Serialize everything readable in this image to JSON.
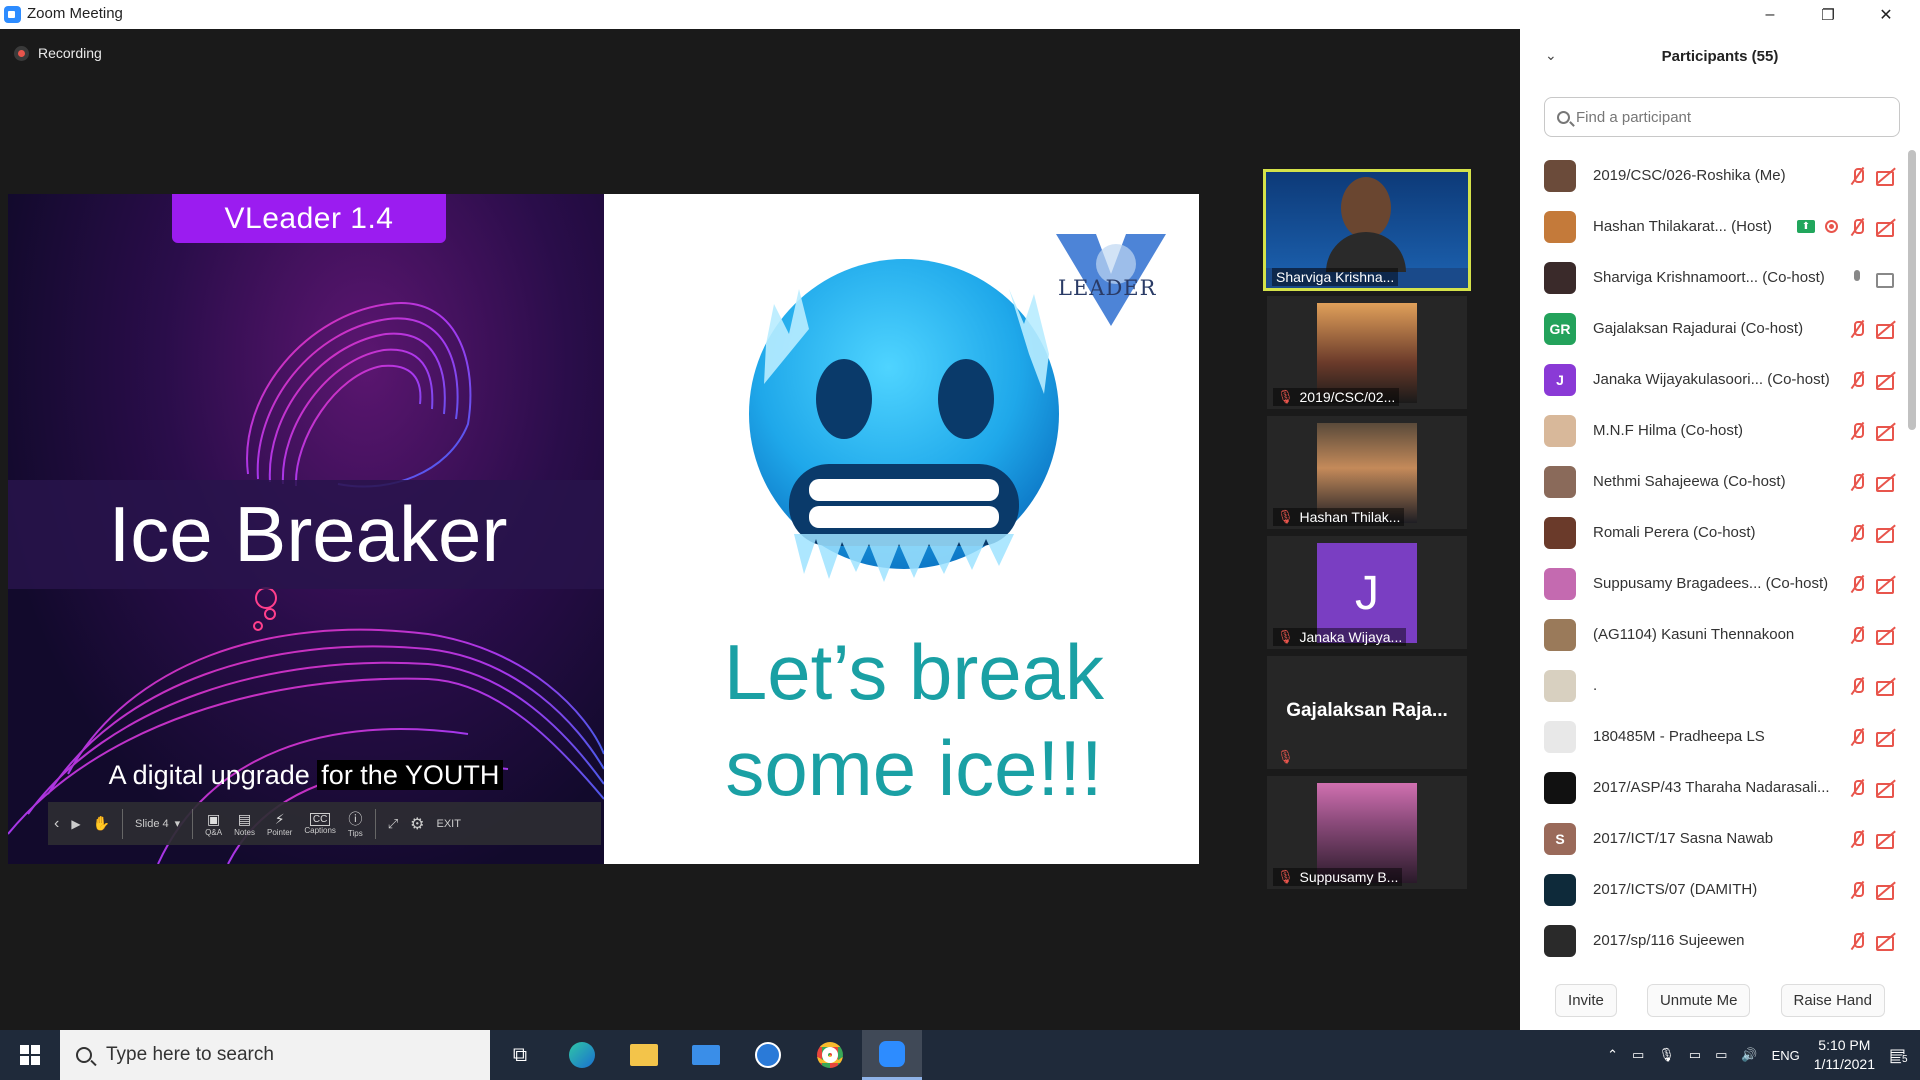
{
  "window": {
    "title": "Zoom Meeting",
    "minimize": "–",
    "restore": "❐",
    "close": "✕"
  },
  "meeting": {
    "recording_label": "Recording",
    "slide": {
      "badge": "VLeader 1.4",
      "headline": "Ice Breaker",
      "tagline_a": "A digital upgrade",
      "tagline_b": "for the YOUTH",
      "right_text_line1": "Let’s break",
      "right_text_line2": "some ice!!!",
      "logo_text": "LEADER",
      "toolbar": {
        "prev": "‹",
        "play": "▶",
        "slide_label": "Slide 4",
        "items": [
          {
            "icon": "▣",
            "label": "Q&A"
          },
          {
            "icon": "▤",
            "label": "Notes"
          },
          {
            "icon": "⚡",
            "label": "Pointer"
          },
          {
            "icon": "CC",
            "label": "Captions"
          },
          {
            "icon": "ⓘ",
            "label": "Tips"
          }
        ],
        "exit": "EXIT"
      }
    },
    "tiles": [
      {
        "name": "Sharviga Krishna..."
      },
      {
        "name": "2019/CSC/02..."
      },
      {
        "name": "Hashan Thilak..."
      },
      {
        "name": "Janaka Wijaya...",
        "initial": "J"
      },
      {
        "name": "Gajalaksan  Raja..."
      },
      {
        "name": "Suppusamy B..."
      }
    ]
  },
  "participants": {
    "title": "Participants (55)",
    "search_placeholder": "Find a participant",
    "list": [
      {
        "name": "2019/CSC/026-Roshika (Me)",
        "avatar": "",
        "color": "#6b4b3a"
      },
      {
        "name": "Hashan Thilakarat...  (Host)",
        "avatar": "",
        "color": "#c47a3a"
      },
      {
        "name": "Sharviga Krishnamoort...  (Co-host)",
        "avatar": "",
        "color": "#3a2a2a"
      },
      {
        "name": "Gajalaksan Rajadurai (Co-host)",
        "avatar": "GR",
        "color": "#23a25b"
      },
      {
        "name": "Janaka Wijayakulasoori...  (Co-host)",
        "avatar": "J",
        "color": "#8a3ad6"
      },
      {
        "name": "M.N.F Hilma (Co-host)",
        "avatar": "",
        "color": "#d8b89a"
      },
      {
        "name": "Nethmi Sahajeewa (Co-host)",
        "avatar": "",
        "color": "#8a6a5a"
      },
      {
        "name": "Romali Perera (Co-host)",
        "avatar": "",
        "color": "#6a3a2a"
      },
      {
        "name": "Suppusamy Bragadees...  (Co-host)",
        "avatar": "",
        "color": "#c46ab0"
      },
      {
        "name": "(AG1104) Kasuni Thennakoon",
        "avatar": "",
        "color": "#9a7a5a"
      },
      {
        "name": ".",
        "avatar": "",
        "color": "#d8d0c0"
      },
      {
        "name": "180485M - Pradheepa LS",
        "avatar": "",
        "color": "#e8e8e8"
      },
      {
        "name": "2017/ASP/43 Tharaha Nadarasali...",
        "avatar": "",
        "color": "#111111"
      },
      {
        "name": "2017/ICT/17 Sasna Nawab",
        "avatar": "S",
        "color": "#9a6a5a"
      },
      {
        "name": "2017/ICTS/07 (DAMITH)",
        "avatar": "",
        "color": "#0e2a3a"
      },
      {
        "name": "2017/sp/116 Sujeewen",
        "avatar": "",
        "color": "#2a2a2a"
      }
    ],
    "buttons": {
      "invite": "Invite",
      "unmute": "Unmute Me",
      "raise": "Raise Hand"
    }
  },
  "taskbar": {
    "search_placeholder": "Type here to search",
    "tray_lang": "ENG",
    "time": "5:10 PM",
    "date": "1/11/2021",
    "notif_count": "5"
  }
}
